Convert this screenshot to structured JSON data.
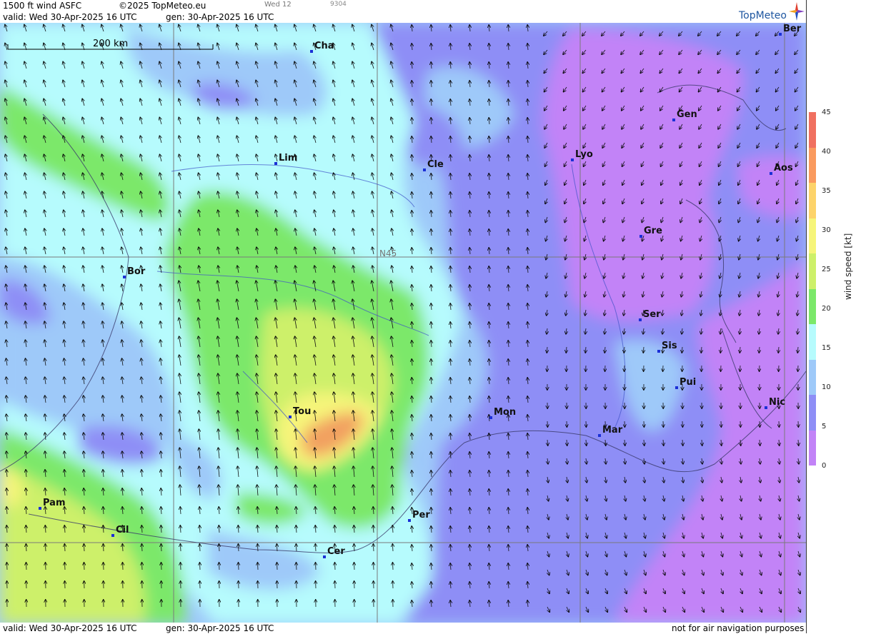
{
  "header": {
    "product": "1500 ft wind ASFC",
    "copyright": "©2025 TopMeteo.eu",
    "run_day": "Wed 12",
    "code": "9304",
    "valid": "valid:  Wed  30-Apr-2025  16 UTC",
    "gen": "gen: 30-Apr-2025 16 UTC",
    "brand": "TopMeteo"
  },
  "footer": {
    "valid": "valid:  Wed  30-Apr-2025  16 UTC",
    "gen": "gen: 30-Apr-2025 16 UTC",
    "disclaimer": "not for air navigation purposes"
  },
  "map": {
    "scale_label": "200 km",
    "grid_label": "N45",
    "cities": [
      {
        "name": "Cha"
      },
      {
        "name": "Ber"
      },
      {
        "name": "Lim"
      },
      {
        "name": "Cle"
      },
      {
        "name": "Lyo"
      },
      {
        "name": "Gen"
      },
      {
        "name": "Aos"
      },
      {
        "name": "Gre"
      },
      {
        "name": "Bor"
      },
      {
        "name": "Ser"
      },
      {
        "name": "Sis"
      },
      {
        "name": "Pui"
      },
      {
        "name": "Tou"
      },
      {
        "name": "Mon"
      },
      {
        "name": "Mar"
      },
      {
        "name": "Nic"
      },
      {
        "name": "Pam"
      },
      {
        "name": "Per"
      },
      {
        "name": "Cil"
      },
      {
        "name": "Cer"
      }
    ]
  },
  "legend": {
    "unit": "wind  speed  [kt]",
    "ticks": [
      "45",
      "40",
      "35",
      "30",
      "25",
      "20",
      "15",
      "10",
      "5",
      "0"
    ],
    "colors": [
      "#f07060",
      "#fa9a5e",
      "#fdd36a",
      "#f6f57a",
      "#cdf06a",
      "#7be86a",
      "#b6fbfd",
      "#9ec9f9",
      "#8e8ef6",
      "#c283f7"
    ]
  },
  "wind_colors": {
    "violet": "#c283f7",
    "purple": "#8e8ef6",
    "blue": "#9ec9f9",
    "cyan": "#b6fbfd",
    "green": "#7be86a",
    "yellowgreen": "#cdf06a",
    "yellow": "#f6f57a",
    "orange": "#f2a060"
  }
}
